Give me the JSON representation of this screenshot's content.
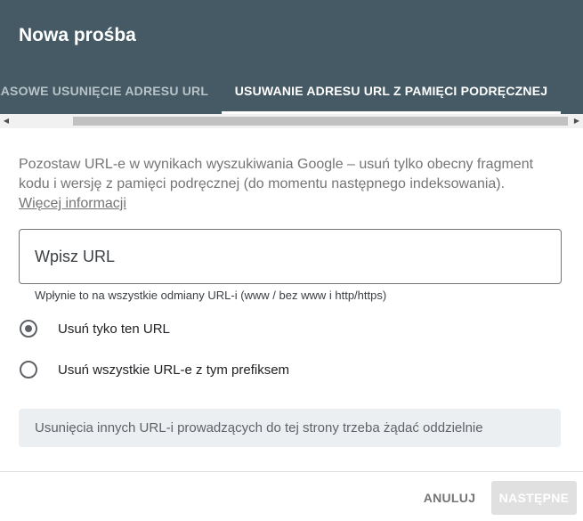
{
  "dialog": {
    "title": "Nowa prośba"
  },
  "tabs": [
    {
      "label": "ZASOWE USUNIĘCIE ADRESU URL",
      "active": false
    },
    {
      "label": "USUWANIE ADRESU URL Z PAMIĘCI PODRĘCZNEJ",
      "active": true
    }
  ],
  "content": {
    "description": "Pozostaw URL-e w wynikach wyszukiwania Google – usuń tylko obecny fragment kodu i wersję z pamięci podręcznej (do momentu następnego indeksowania).",
    "more_link": "Więcej informacji",
    "url_input": {
      "placeholder": "Wpisz URL",
      "value": ""
    },
    "hint": "Wpłynie to na wszystkie odmiany URL-i (www / bez www i http/https)",
    "options": [
      {
        "label": "Usuń tyko ten URL",
        "selected": true
      },
      {
        "label": "Usuń wszystkie URL-e z tym prefiksem",
        "selected": false
      }
    ],
    "info": "Usunięcia innych URL-i prowadzących do tej strony trzeba żądać oddzielnie"
  },
  "footer": {
    "cancel_label": "ANULUJ",
    "next_label": "NASTĘPNE",
    "next_enabled": false
  },
  "colors": {
    "header_bg": "#455a64",
    "active_tab": "#ffffff",
    "inactive_tab": "#b8c3c8",
    "info_bg": "#eceff1",
    "disabled_button": "#e0e0e0"
  },
  "icons": {
    "scroll_left": "scroll-left-arrow-icon",
    "scroll_right": "scroll-right-arrow-icon",
    "radio_selected": "radio-checked-icon",
    "radio_unselected": "radio-unchecked-icon"
  }
}
